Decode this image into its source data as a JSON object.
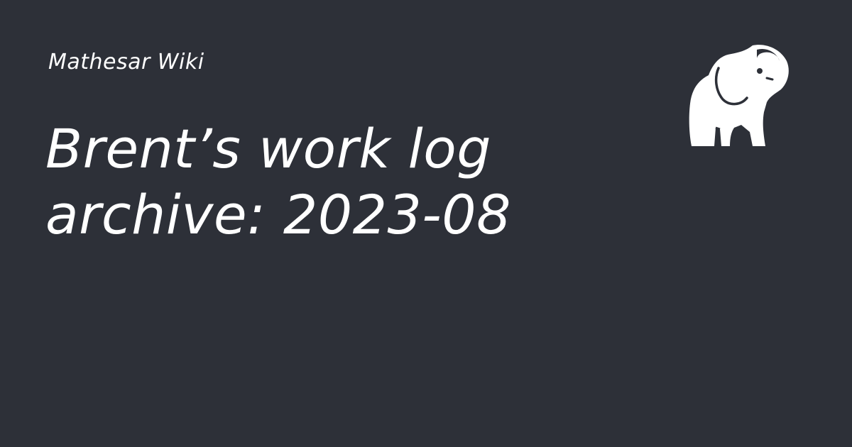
{
  "site": {
    "name": "Mathesar Wiki"
  },
  "page": {
    "title": "Brent’s work log archive: 2023-08"
  },
  "logo": {
    "icon": "elephant-icon",
    "color": "#ffffff"
  },
  "colors": {
    "background": "#2d3038",
    "text": "#ffffff"
  }
}
